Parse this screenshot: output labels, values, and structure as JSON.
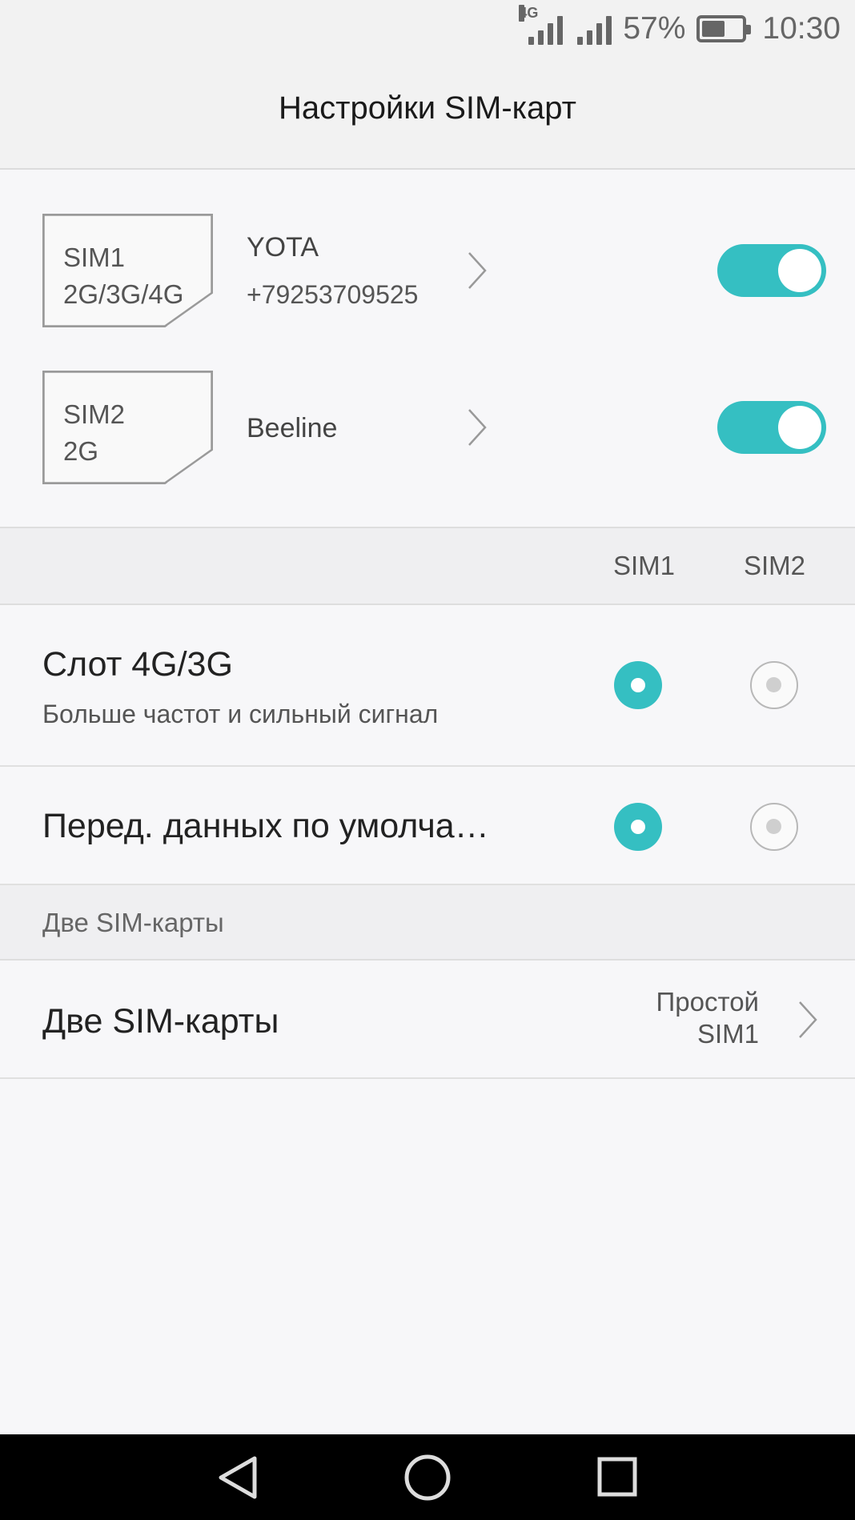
{
  "status_bar": {
    "network_type": "4G",
    "battery_percent": "57%",
    "time": "10:30"
  },
  "header": {
    "title": "Настройки SIM-карт"
  },
  "sims": [
    {
      "card_label": "SIM1",
      "card_bands": "2G/3G/4G",
      "operator": "YOTA",
      "phone": "+79253709525",
      "enabled": true
    },
    {
      "card_label": "SIM2",
      "card_bands": "2G",
      "operator": "Beeline",
      "phone": "",
      "enabled": true
    }
  ],
  "columns": {
    "sim1": "SIM1",
    "sim2": "SIM2"
  },
  "settings": [
    {
      "title": "Слот 4G/3G",
      "subtitle": "Больше частот и сильный сигнал",
      "selected": "SIM1"
    },
    {
      "title": "Перед. данных по умолча…",
      "selected": "SIM1"
    }
  ],
  "dual_section": {
    "header": "Две SIM-карты",
    "row_title": "Две SIM-карты",
    "value_line1": "Простой",
    "value_line2": "SIM1"
  },
  "colors": {
    "accent": "#35bfc2"
  }
}
